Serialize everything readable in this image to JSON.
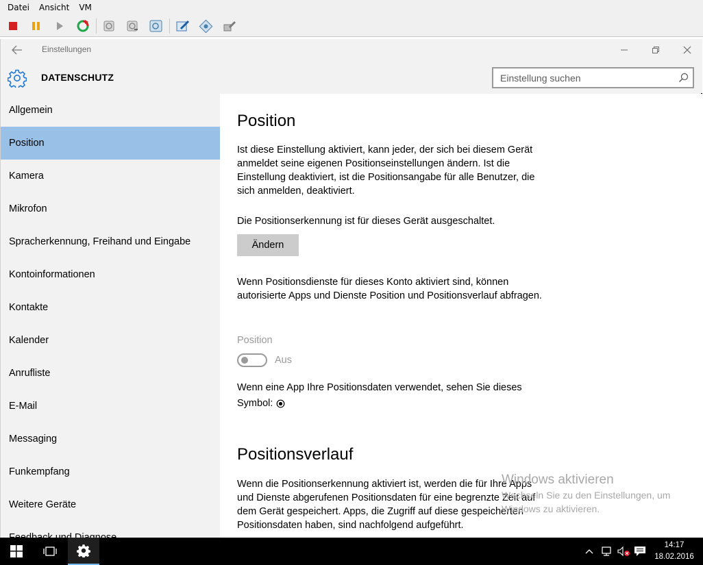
{
  "vm": {
    "menu": [
      "Datei",
      "Ansicht",
      "VM"
    ],
    "toolbar_icons": [
      "stop-icon",
      "pause-icon",
      "play-icon",
      "reset-icon",
      "snapshot-icon",
      "snapshot-revert-icon",
      "snapshot-manager-icon",
      "edit-icon",
      "tools-icon",
      "settings-wrench-icon"
    ]
  },
  "window": {
    "title": "Einstellungen",
    "page_title": "DATENSCHUTZ",
    "search_placeholder": "Einstellung suchen"
  },
  "sidebar": {
    "items": [
      {
        "label": "Allgemein"
      },
      {
        "label": "Position",
        "active": true
      },
      {
        "label": "Kamera"
      },
      {
        "label": "Mikrofon"
      },
      {
        "label": "Spracherkennung, Freihand und Eingabe"
      },
      {
        "label": "Kontoinformationen"
      },
      {
        "label": "Kontakte"
      },
      {
        "label": "Kalender"
      },
      {
        "label": "Anrufliste"
      },
      {
        "label": "E-Mail"
      },
      {
        "label": "Messaging"
      },
      {
        "label": "Funkempfang"
      },
      {
        "label": "Weitere Geräte"
      },
      {
        "label": "Feedback und Diagnose"
      }
    ]
  },
  "content": {
    "position_heading": "Position",
    "position_desc": "Ist diese Einstellung aktiviert, kann jeder, der sich bei diesem Gerät anmeldet seine eigenen Positionseinstellungen ändern. Ist die Einstellung deaktiviert, ist die Positionsangabe für alle Benutzer, die sich anmelden, deaktiviert.",
    "device_status": "Die Positionserkennung ist für dieses Gerät ausgeschaltet.",
    "change_button": "Ändern",
    "account_desc": "Wenn Positionsdienste für dieses Konto aktiviert sind, können autorisierte Apps und Dienste Position und Positionsverlauf abfragen.",
    "toggle_label": "Position",
    "toggle_state": "Aus",
    "symbol_text_1": "Wenn eine App Ihre Positionsdaten verwendet, sehen Sie dieses",
    "symbol_text_2": "Symbol:",
    "history_heading": "Positionsverlauf",
    "history_desc": "Wenn die Positionserkennung aktiviert ist, werden die für Ihre Apps und Dienste abgerufenen Positionsdaten für eine begrenzte Zeit auf dem Gerät gespeichert. Apps, die Zugriff auf diese gespeicherten Positionsdaten haben, sind nachfolgend aufgeführt."
  },
  "watermark": {
    "title": "Windows aktivieren",
    "subtitle": "Wechseln Sie zu den Einstellungen, um Windows zu aktivieren."
  },
  "taskbar": {
    "time": "14:17",
    "date": "18.02.2016"
  },
  "colors": {
    "accent": "#0078d7",
    "active_nav": "#99c1e8",
    "sidebar_bg": "#f2f2f2",
    "disabled_text": "#9a9a9a"
  }
}
